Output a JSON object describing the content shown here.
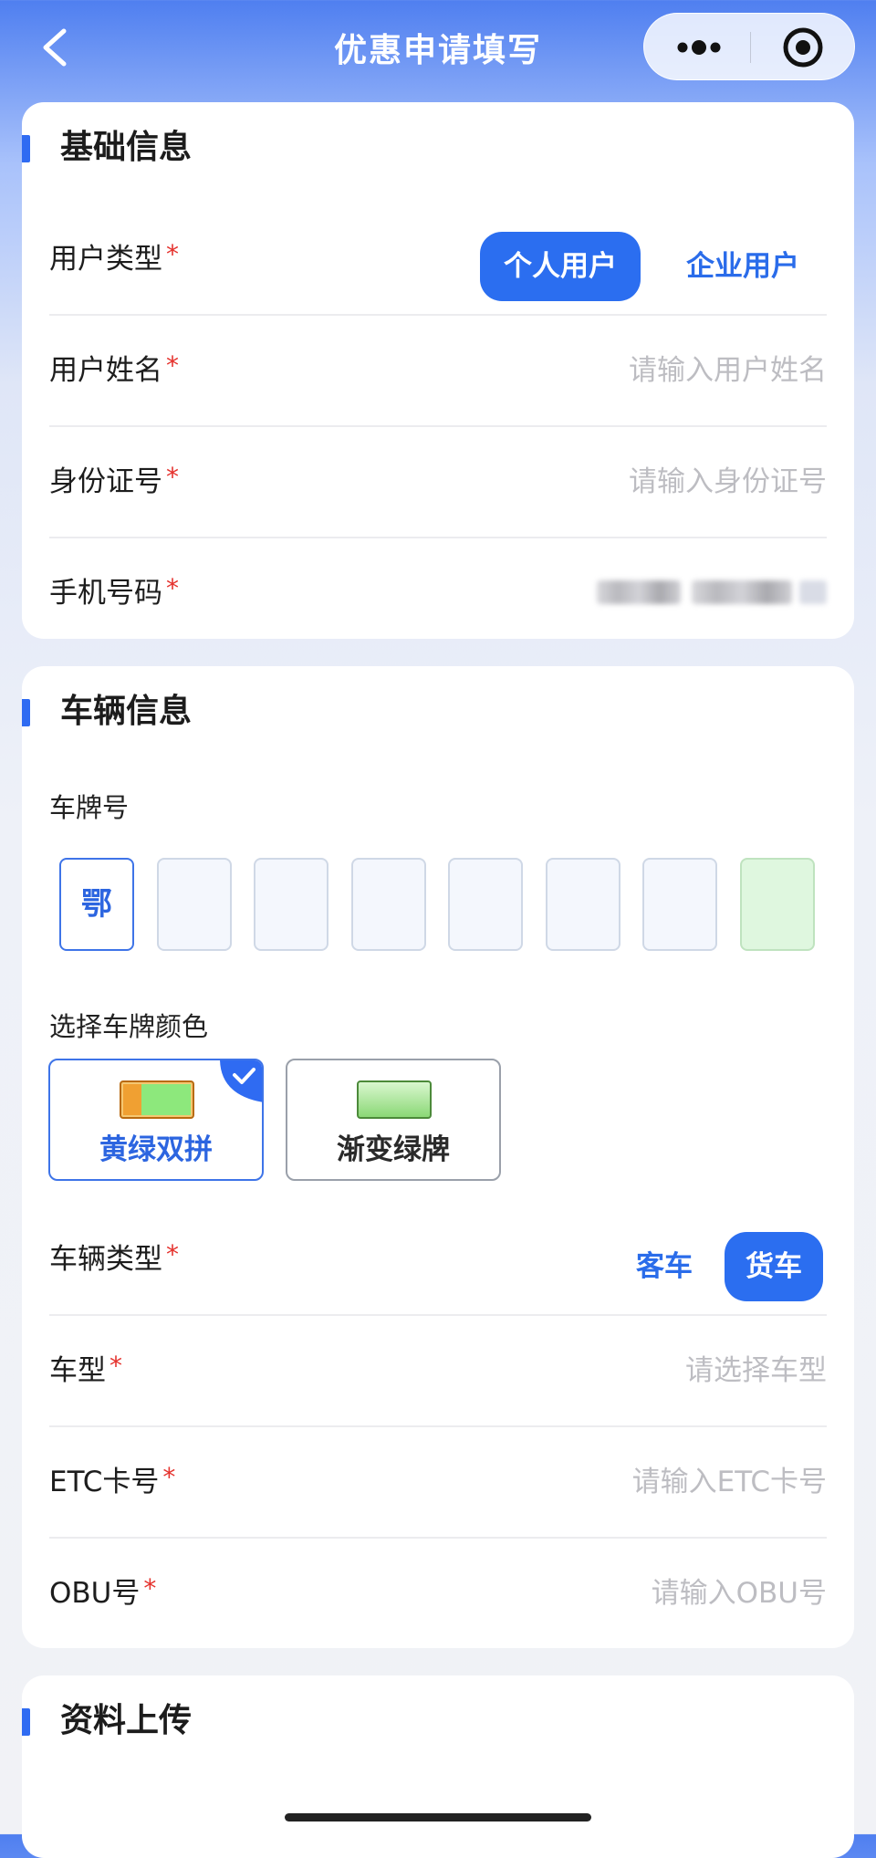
{
  "nav": {
    "title": "优惠申请填写",
    "back_icon": "chevron-left-icon",
    "more_icon": "more-dots-icon",
    "close_icon": "target-circle-icon"
  },
  "basic": {
    "section_title": "基础信息",
    "user_type": {
      "label": "用户类型",
      "options": [
        "个人用户",
        "企业用户"
      ],
      "selected": "个人用户"
    },
    "user_name": {
      "label": "用户姓名",
      "value": "",
      "placeholder": "请输入用户姓名"
    },
    "id_number": {
      "label": "身份证号",
      "value": "",
      "placeholder": "请输入身份证号"
    },
    "phone": {
      "label": "手机号码"
    }
  },
  "vehicle": {
    "section_title": "车辆信息",
    "plate_label": "车牌号",
    "plate_province": "鄂",
    "plate_color_label": "选择车牌颜色",
    "plate_colors": [
      {
        "label": "黄绿双拼",
        "selected": true
      },
      {
        "label": "渐变绿牌",
        "selected": false
      }
    ],
    "vehicle_type": {
      "label": "车辆类型",
      "options": [
        "客车",
        "货车"
      ],
      "selected": "货车"
    },
    "model": {
      "label": "车型",
      "value": "",
      "placeholder": "请选择车型"
    },
    "etc_card": {
      "label": "ETC卡号",
      "value": "",
      "placeholder": "请输入ETC卡号"
    },
    "obu": {
      "label": "OBU号",
      "value": "",
      "placeholder": "请输入OBU号"
    }
  },
  "upload": {
    "section_title": "资料上传"
  },
  "required_mark": "*",
  "colors": {
    "accent": "#2b6ef0",
    "required": "#e5322d",
    "placeholder": "#bdbdc2"
  }
}
